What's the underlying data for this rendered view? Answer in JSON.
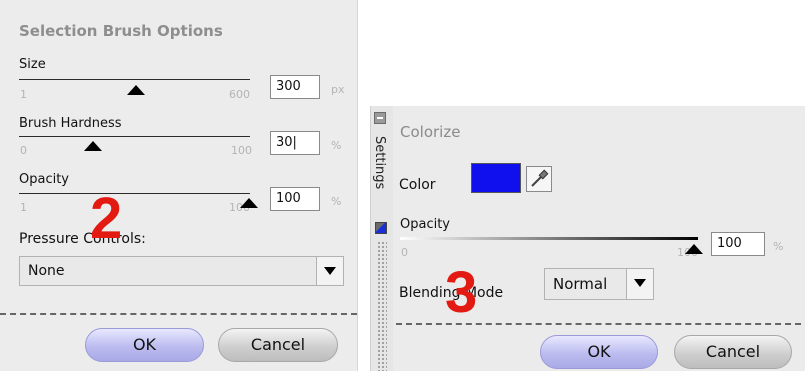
{
  "left_panel": {
    "title": "Selection Brush Options",
    "size": {
      "label": "Size",
      "min": "1",
      "max": "600",
      "value": "300",
      "unit": "px",
      "level": 0.5
    },
    "hardness": {
      "label": "Brush Hardness",
      "min": "0",
      "max": "100",
      "value": "30|",
      "unit": "%",
      "level": 0.3
    },
    "opacity": {
      "label": "Opacity",
      "min": "1",
      "max": "100",
      "value": "100",
      "unit": "%",
      "level": 1.0
    },
    "pressure": {
      "label": "Pressure Controls:",
      "selected": "None"
    },
    "ok_label": "OK",
    "cancel_label": "Cancel",
    "step_number": "2"
  },
  "sidebar": {
    "tab_label": "Settings"
  },
  "right_panel": {
    "title": "Colorize",
    "color_label": "Color",
    "color_value": "#1010ee",
    "opacity": {
      "label": "Opacity",
      "min": "0",
      "max": "100",
      "value": "100",
      "unit": "%",
      "level": 1.0
    },
    "blending": {
      "label": "Blending Mode",
      "selected": "Normal"
    },
    "ok_label": "OK",
    "cancel_label": "Cancel",
    "step_number": "3"
  },
  "colors": {
    "accent_red": "#e31a12",
    "ok_button": "#bcbcf0",
    "swatch_blue": "#1010ee"
  },
  "icons": [
    "collapse-icon",
    "eyedropper-icon",
    "chevron-down-icon",
    "slider-thumb-icon"
  ]
}
